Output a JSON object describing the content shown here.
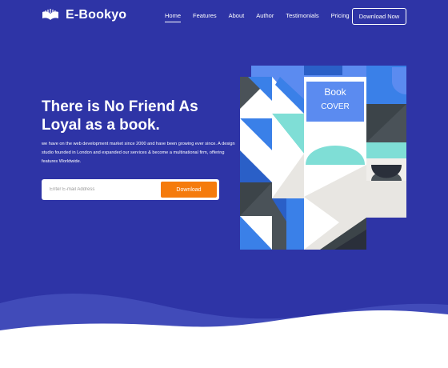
{
  "nav": {
    "brand": "E-Bookyo",
    "items": [
      {
        "label": "Home",
        "active": true
      },
      {
        "label": "Features"
      },
      {
        "label": "About"
      },
      {
        "label": "Author"
      },
      {
        "label": "Testimonials"
      },
      {
        "label": "Pricing"
      }
    ],
    "cta_label": "Download Now"
  },
  "hero": {
    "title": "There is No Friend As Loyal as a book.",
    "description": "we have on the web development market since 2000 and have been growing ever since. A design studio founded in London and expanded our services & become a multinational firm, offering features Worldwide.",
    "email_placeholder": "Enter E-mail Address",
    "download_label": "Download"
  },
  "book": {
    "cover_line1": "Book",
    "cover_line2": "COVER"
  },
  "colors": {
    "background": "#2e34a6",
    "accent": "#f57b0c",
    "wave": "#ffffff",
    "cover_blue": "#5b8bf0"
  },
  "icons": {
    "logo": "open-book-icon"
  }
}
